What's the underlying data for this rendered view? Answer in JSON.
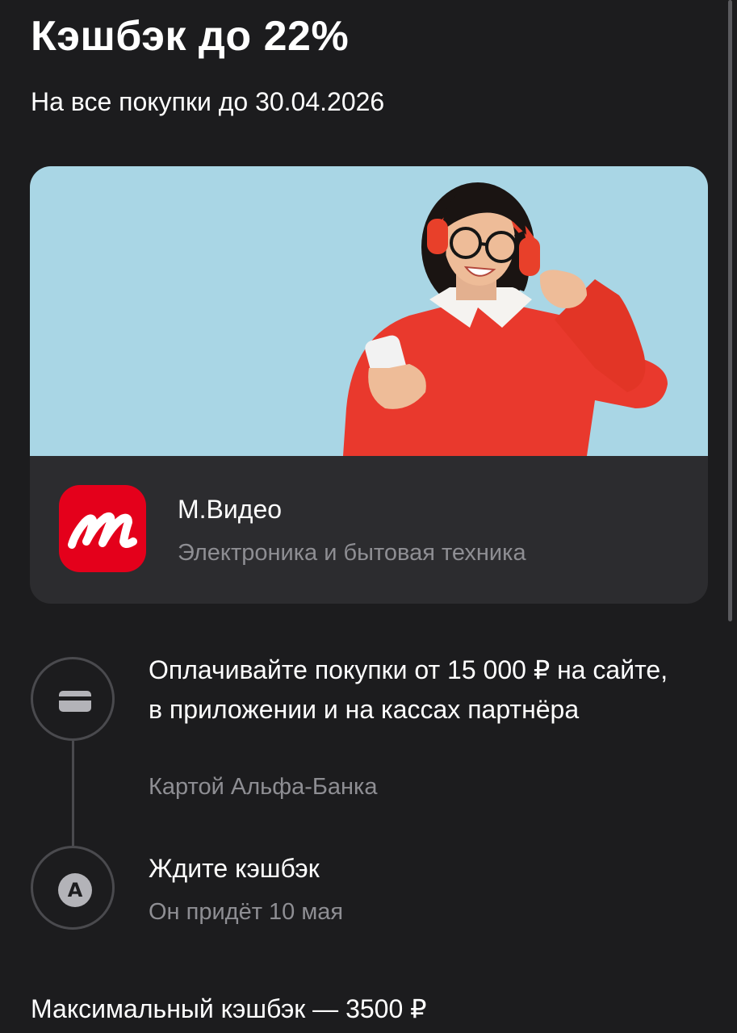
{
  "header": {
    "title": "Кэшбэк до 22%",
    "subtitle": "На все покупки до 30.04.2026"
  },
  "promo": {
    "image_icon": "woman-with-headphones-and-phone-photo",
    "partner": {
      "logo_icon": "mvideo-logo-icon",
      "logo_color": "#e4001b",
      "name": "М.Видео",
      "category": "Электроника и бытовая техника"
    }
  },
  "steps": [
    {
      "icon": "credit-card-icon",
      "title": "Оплачивайте покупки от 15 000 ₽ на сайте, в приложении и на кассах партнёра",
      "note": "Картой Альфа-Банка"
    },
    {
      "icon": "alfa-bank-icon",
      "icon_letter": "A",
      "title": "Ждите кэшбэк",
      "note": "Он придёт 10 мая"
    }
  ],
  "footer": {
    "max_cashback": "Максимальный кэшбэк — 3500 ₽"
  },
  "colors": {
    "background": "#1c1c1e",
    "card": "#2c2c2f",
    "secondary_text": "#8e8e93",
    "brand_red": "#e4001b"
  }
}
